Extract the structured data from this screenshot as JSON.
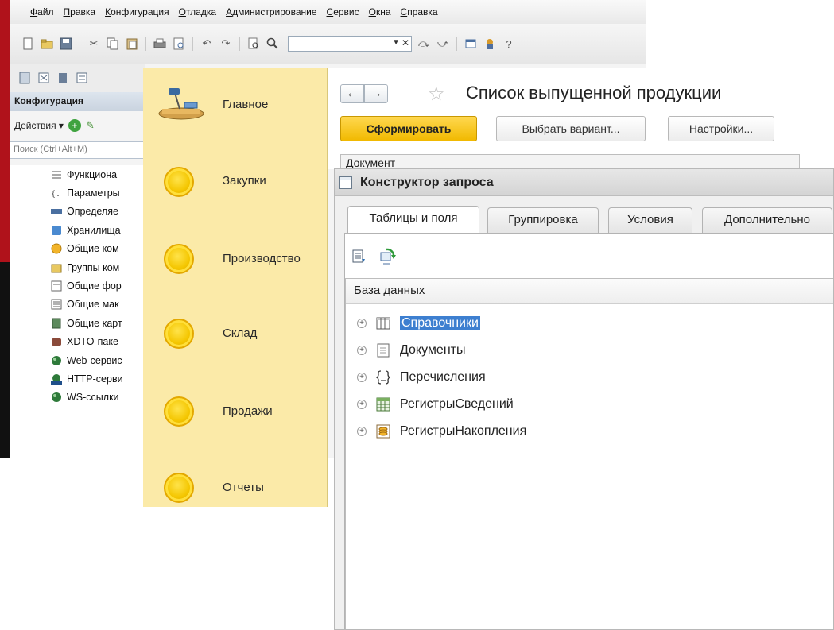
{
  "config_window": {
    "menu": [
      "Файл",
      "Правка",
      "Конфигурация",
      "Отладка",
      "Администрирование",
      "Сервис",
      "Окна",
      "Справка"
    ],
    "panel_title": "Конфигурация",
    "actions_label": "Действия ▾",
    "search_placeholder": "Поиск (Ctrl+Alt+M)",
    "tree_items": [
      {
        "label": "Функциона",
        "icon": "functional-options-icon"
      },
      {
        "label": "Параметры",
        "icon": "parameters-icon"
      },
      {
        "label": "Определяе",
        "icon": "defined-types-icon"
      },
      {
        "label": "Хранилища",
        "icon": "storage-icon"
      },
      {
        "label": "Общие ком",
        "icon": "common-commands-icon"
      },
      {
        "label": "Группы ком",
        "icon": "command-groups-icon"
      },
      {
        "label": "Общие фор",
        "icon": "common-forms-icon"
      },
      {
        "label": "Общие мак",
        "icon": "common-templates-icon"
      },
      {
        "label": "Общие карт",
        "icon": "common-pictures-icon"
      },
      {
        "label": "XDTO-паке",
        "icon": "xdto-packages-icon"
      },
      {
        "label": "Web-сервис",
        "icon": "web-services-icon"
      },
      {
        "label": "HTTP-серви",
        "icon": "http-services-icon"
      },
      {
        "label": "WS-ссылки",
        "icon": "ws-links-icon"
      }
    ]
  },
  "sections_panel": {
    "items": [
      "Главное",
      "Закупки",
      "Производство",
      "Склад",
      "Продажи",
      "Отчеты"
    ],
    "colors": {
      "background": "#fbeaa8",
      "icon": "#f4c600"
    }
  },
  "report_window": {
    "title": "Список выпущенной продукции",
    "generate_button": "Сформировать",
    "variant_button": "Выбрать вариант...",
    "settings_button": "Настройки...",
    "column_header": "Документ"
  },
  "query_designer": {
    "title": "Конструктор запроса",
    "tabs": [
      "Таблицы и поля",
      "Группировка",
      "Условия",
      "Дополнительно"
    ],
    "active_tab": "Таблицы и поля",
    "tree_header": "База данных",
    "tree_items": [
      {
        "label": "Справочники",
        "icon": "catalogs-icon",
        "selected": true
      },
      {
        "label": "Документы",
        "icon": "documents-icon",
        "selected": false
      },
      {
        "label": "Перечисления",
        "icon": "enums-icon",
        "selected": false
      },
      {
        "label": "РегистрыСведений",
        "icon": "info-registers-icon",
        "selected": false
      },
      {
        "label": "РегистрыНакопления",
        "icon": "accumulation-registers-icon",
        "selected": false
      }
    ],
    "colors": {
      "selection": "#3d7fd0"
    }
  }
}
